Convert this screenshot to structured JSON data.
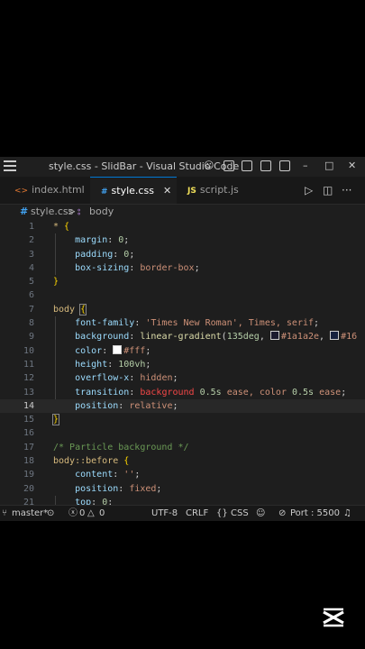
{
  "titlebar": {
    "title": "style.css - SlidBar - Visual Studio Code",
    "minimize": "–",
    "maximize": "□",
    "close": "✕"
  },
  "tabs": [
    {
      "label": "index.html",
      "icon": "<>",
      "active": false
    },
    {
      "label": "style.css",
      "icon": "#",
      "active": true
    },
    {
      "label": "script.js",
      "icon": "JS",
      "active": false
    }
  ],
  "tab_close": "✕",
  "tab_more": "···",
  "breadcrumb": {
    "file_icon": "#",
    "file": "style.css",
    "separator": ">",
    "symbol_icon": "⦂",
    "symbol": "body"
  },
  "code": {
    "current_line": 14,
    "lines": [
      {
        "n": "1"
      },
      {
        "n": "2"
      },
      {
        "n": "3"
      },
      {
        "n": "4"
      },
      {
        "n": "5"
      },
      {
        "n": "6"
      },
      {
        "n": "7"
      },
      {
        "n": "8"
      },
      {
        "n": "9"
      },
      {
        "n": "10"
      },
      {
        "n": "11"
      },
      {
        "n": "12"
      },
      {
        "n": "13"
      },
      {
        "n": "14"
      },
      {
        "n": "15"
      },
      {
        "n": "16"
      },
      {
        "n": "17"
      },
      {
        "n": "18"
      },
      {
        "n": "19"
      },
      {
        "n": "20"
      },
      {
        "n": "21"
      }
    ],
    "tokens": {
      "l1_sel": "* ",
      "l1_brace": "{",
      "l2_prop": "margin",
      "l2_val": "0",
      "l3_prop": "padding",
      "l3_val": "0",
      "l4_prop": "box-sizing",
      "l4_val": "border-box",
      "l5_brace": "}",
      "l7_sel": "body ",
      "l7_brace": "{",
      "l8_prop": "font-family",
      "l8_val": "'Times New Roman', Times, serif",
      "l9_prop": "background",
      "l9_fn": "linear-gradient",
      "l9_arg1": "135deg",
      "l9_c1": "#1a1a2e",
      "l9_c2": "#16",
      "l10_prop": "color",
      "l10_val": "#fff",
      "l11_prop": "height",
      "l11_val": "100vh",
      "l12_prop": "overflow-x",
      "l12_val": "hidden",
      "l13_prop": "transition",
      "l13_v1": "background",
      "l13_v2": "0.5s",
      "l13_v3": "ease, color",
      "l13_v4": "0.5s",
      "l13_v5": "ease",
      "l14_prop": "position",
      "l14_val": "relative",
      "l15_brace": "}",
      "l17_cmt": "/* Particle background */",
      "l18_sel": "body::before ",
      "l18_brace": "{",
      "l19_prop": "content",
      "l19_val": "''",
      "l20_prop": "position",
      "l20_val": "fixed",
      "l21_prop": "top",
      "l21_val": "0"
    }
  },
  "status": {
    "branch": "master*",
    "errors": "0",
    "warnings": "0",
    "encoding": "UTF-8",
    "eol": "CRLF",
    "language": "CSS",
    "port": "Port : 5500"
  },
  "colors": {
    "accent": "#0078d4",
    "editor_bg": "#1e1e1e",
    "titlebar_bg": "#1f1f1f"
  }
}
